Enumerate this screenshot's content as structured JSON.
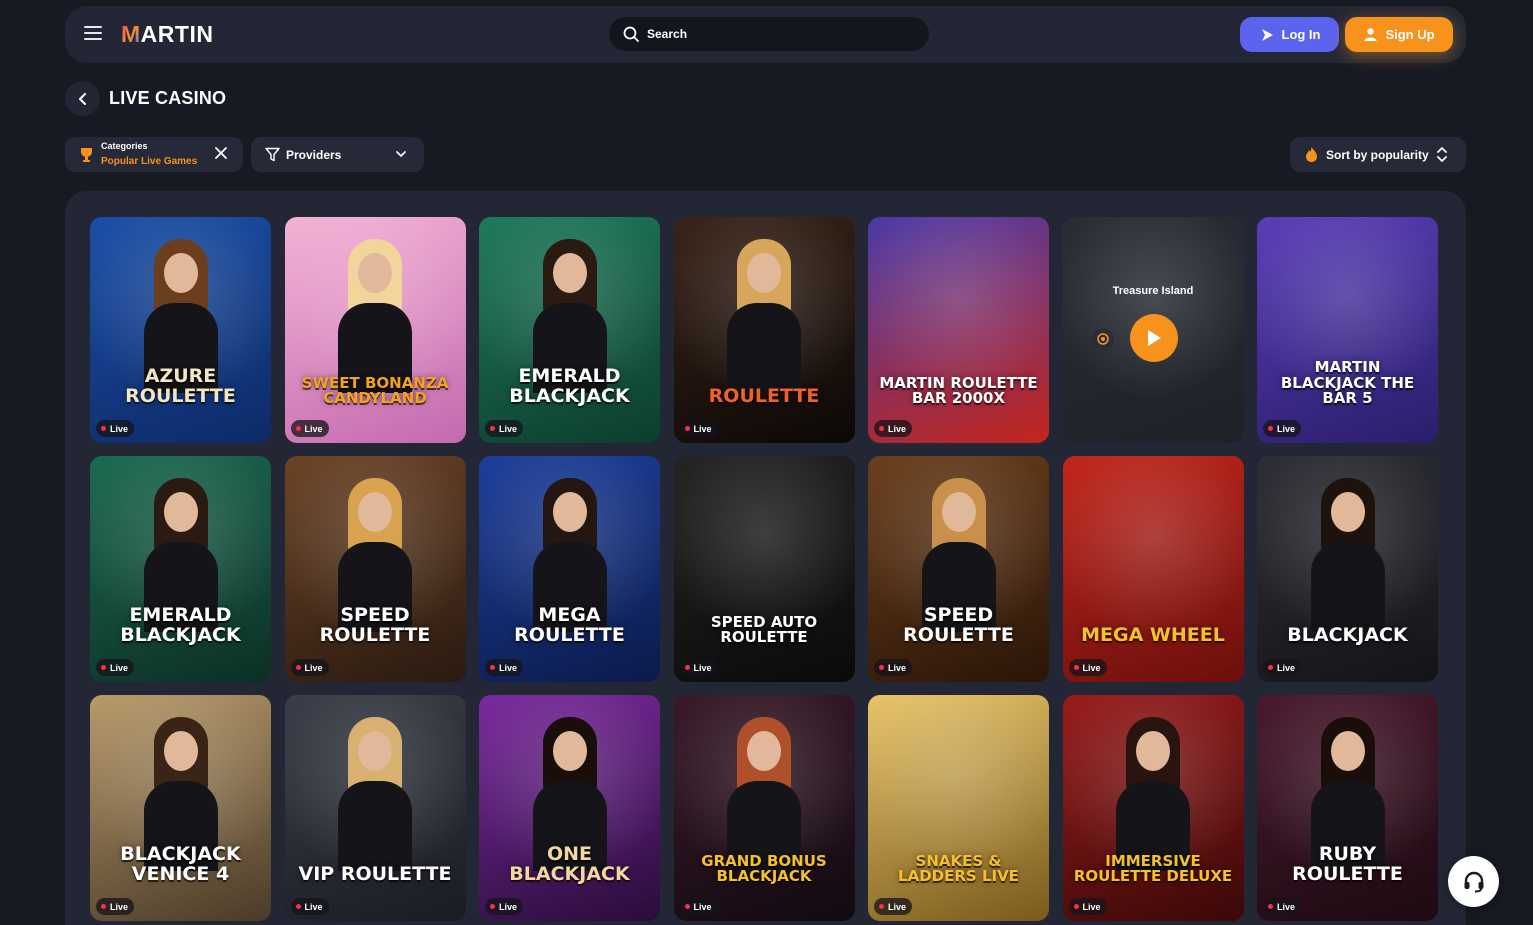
{
  "header": {
    "logo": "MARTIN",
    "search": {
      "placeholder": "Search"
    },
    "login_label": "Log In",
    "signup_label": "Sign Up"
  },
  "page": {
    "title": "LIVE CASINO"
  },
  "filters": {
    "category_caption": "Categories",
    "category_value": "Popular Live Games",
    "providers_label": "Providers",
    "sort_label": "Sort by popularity"
  },
  "badge_label": "Live",
  "games": [
    {
      "title": "Azure Roulette",
      "live": true,
      "bg": "#1b4fa8",
      "bg2": "#0d2a66",
      "hair": "#6b3f1e",
      "text_color": "#f4e6c0"
    },
    {
      "title": "Sweet Bonanza Candyland",
      "live": true,
      "bg": "#f3b2d4",
      "bg2": "#c46ab0",
      "hair": "#f2d59a",
      "text_color": "#f6a31c"
    },
    {
      "title": "Emerald Blackjack",
      "live": true,
      "bg": "#1e7a5c",
      "bg2": "#0d3d2e",
      "hair": "#2a1a12",
      "text_color": "#ffffff"
    },
    {
      "title": "Roulette",
      "live": true,
      "bg": "#3a2418",
      "bg2": "#0c0806",
      "hair": "#d7a65a",
      "text_color": "#f0622a"
    },
    {
      "title": "Martin Roulette Bar 2000x",
      "live": true,
      "bg": "#4b3aa8",
      "bg2": "#c2261c",
      "hair": null,
      "text_color": "#ffffff"
    },
    {
      "title": "Treasure Island",
      "live": false,
      "bg": "#2b2d36",
      "bg2": "#1f2129",
      "hair": null,
      "text_color": "#ffffff"
    },
    {
      "title": "Martin Blackjack The Bar 5",
      "live": true,
      "bg": "#5a3db8",
      "bg2": "#2a1e6b",
      "hair": null,
      "text_color": "#ffffff"
    },
    {
      "title": "Emerald Blackjack",
      "live": true,
      "bg": "#1c6a52",
      "bg2": "#0c2f24",
      "hair": "#2a1a12",
      "text_color": "#ffffff"
    },
    {
      "title": "Speed Roulette",
      "live": true,
      "bg": "#6b4326",
      "bg2": "#2a1a10",
      "hair": "#d8a24e",
      "text_color": "#ffffff"
    },
    {
      "title": "Mega Roulette",
      "live": true,
      "bg": "#1d3f9c",
      "bg2": "#0b1a4a",
      "hair": "#241610",
      "text_color": "#ffffff"
    },
    {
      "title": "Speed Auto Roulette",
      "live": true,
      "bg": "#242424",
      "bg2": "#0a0a0a",
      "hair": null,
      "text_color": "#ffffff"
    },
    {
      "title": "Speed Roulette",
      "live": true,
      "bg": "#6b3f1c",
      "bg2": "#2a1508",
      "hair": "#c8904a",
      "text_color": "#ffffff"
    },
    {
      "title": "Mega Wheel",
      "live": true,
      "bg": "#c2261c",
      "bg2": "#6b0f0c",
      "hair": null,
      "text_color": "#f6c02a"
    },
    {
      "title": "Blackjack",
      "live": true,
      "bg": "#2e2e36",
      "bg2": "#141418",
      "hair": "#1e120c",
      "text_color": "#ffffff"
    },
    {
      "title": "Blackjack Venice 4",
      "live": true,
      "bg": "#b89a6a",
      "bg2": "#4a3a28",
      "hair": "#3a2416",
      "text_color": "#ffffff"
    },
    {
      "title": "VIP Roulette",
      "live": true,
      "bg": "#3a3e48",
      "bg2": "#1a1c22",
      "hair": "#d8b070",
      "text_color": "#ffffff"
    },
    {
      "title": "One Blackjack",
      "live": true,
      "bg": "#7a2a9e",
      "bg2": "#2a0c3a",
      "hair": "#1a0e0a",
      "text_color": "#f2d7a0"
    },
    {
      "title": "Grand Bonus Blackjack",
      "live": true,
      "bg": "#3a1a2a",
      "bg2": "#120a10",
      "hair": "#b0502a",
      "text_color": "#f6c02a"
    },
    {
      "title": "Snakes & Ladders Live",
      "live": true,
      "bg": "#e8c46a",
      "bg2": "#7a5a1c",
      "hair": null,
      "text_color": "#f6c02a"
    },
    {
      "title": "Immersive Roulette Deluxe",
      "live": true,
      "bg": "#9a1c1c",
      "bg2": "#3a0808",
      "hair": "#2a1410",
      "text_color": "#f6c02a"
    },
    {
      "title": "Ruby Roulette",
      "live": true,
      "bg": "#4a1a2e",
      "bg2": "#1c0a12",
      "hair": "#1a0e0a",
      "text_color": "#ffffff"
    }
  ],
  "colors": {
    "accent_orange": "#f7921c",
    "accent_blue": "#5b63ef",
    "live_dot": "#ff2d45",
    "panel": "#232735",
    "background": "#171a23"
  }
}
